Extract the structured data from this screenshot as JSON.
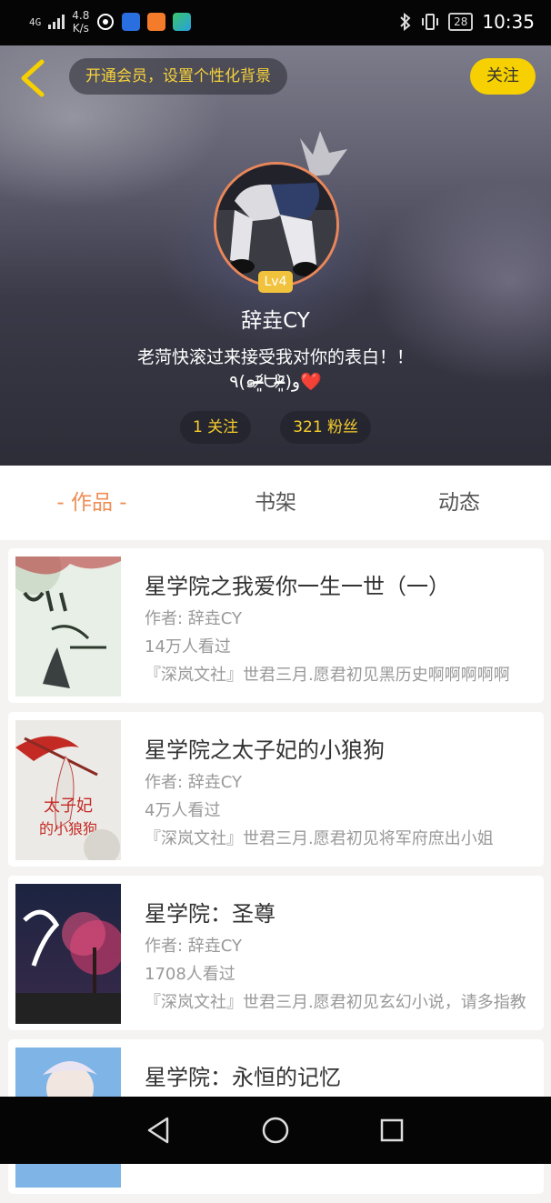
{
  "status_bar": {
    "network": "4G",
    "speed_value": "4.8",
    "speed_unit": "K/s",
    "battery": "28",
    "time": "10:35"
  },
  "header": {
    "vip_text": "开通会员，设置个性化背景",
    "follow_label": "关注",
    "level": "Lv4",
    "username": "辞垚CY",
    "bio_line1": "老菏快滚过来接受我对你的表白！！",
    "bio_line2": "٩(๑ᵒ̴̶̷͈᷄ᗨᵒ̴̶̷͈᷅)و❤️",
    "following": "1 关注",
    "fans": "321 粉丝"
  },
  "tabs": [
    {
      "label": "- 作品 -"
    },
    {
      "label": "书架"
    },
    {
      "label": "动态"
    }
  ],
  "books": [
    {
      "title": "星学院之我爱你一生一世（一）",
      "author": "作者: 辞垚CY",
      "views": "14万人看过",
      "desc": "『深岚文社』世君三月.愿君初见黑历史啊啊啊啊啊"
    },
    {
      "title": "星学院之太子妃的小狼狗",
      "author": "作者: 辞垚CY",
      "views": "4万人看过",
      "desc": "『深岚文社』世君三月.愿君初见将军府庶出小姐"
    },
    {
      "title": "星学院：圣尊",
      "author": "作者: 辞垚CY",
      "views": "1708人看过",
      "desc": "『深岚文社』世君三月.愿君初见玄幻小说，请多指教"
    },
    {
      "title": "星学院：永恒的记忆",
      "author": "",
      "views": "",
      "desc": ""
    }
  ],
  "colors": {
    "accent": "#ee8e55",
    "gold": "#f5cd2c",
    "follow_bg": "#f6d000"
  },
  "icons": {
    "back": "chevron-left-icon",
    "crown": "crown-icon",
    "nav_back": "triangle-back-icon",
    "nav_home": "circle-home-icon",
    "nav_recent": "square-recent-icon"
  }
}
